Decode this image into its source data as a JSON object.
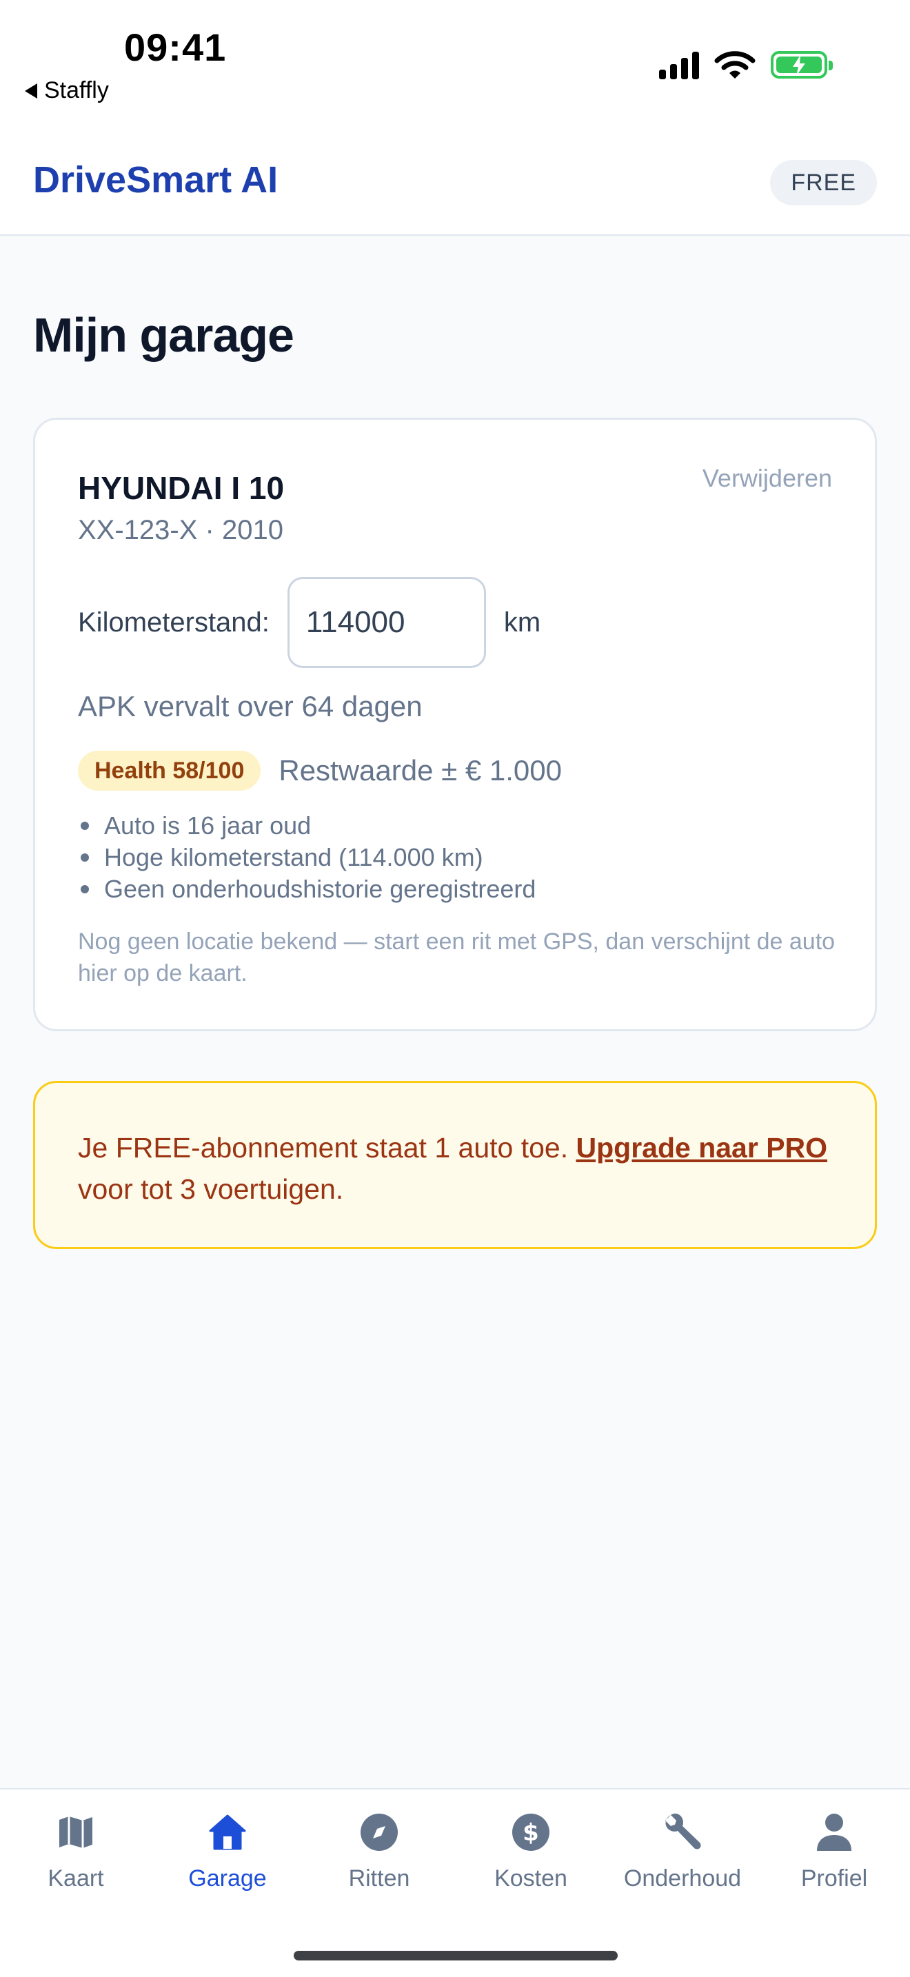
{
  "status_bar": {
    "time": "09:41",
    "back_app": "Staffly"
  },
  "header": {
    "brand": "DriveSmart AI",
    "plan": "FREE"
  },
  "page": {
    "title": "Mijn garage"
  },
  "vehicle_card": {
    "name": "HYUNDAI I 10",
    "remove_label": "Verwijderen",
    "plate": "XX-123-X",
    "meta_separator": " · ",
    "year": "2010",
    "odometer_label": "Kilometerstand:",
    "odometer_value": "114000",
    "odometer_unit": "km",
    "apk_text": "APK vervalt over 64 dagen",
    "health_badge": "Health 58/100",
    "health_score": 58,
    "residual_value": "Restwaarde ± € 1.000",
    "reasons": [
      "Auto is 16 jaar oud",
      "Hoge kilometerstand (114.000 km)",
      "Geen onderhoudshistorie geregistreerd"
    ],
    "location_note": "Nog geen locatie bekend — start een rit met GPS, dan verschijnt de auto hier op de kaart."
  },
  "upgrade_notice": {
    "text_before": "Je FREE-abonnement staat 1 auto toe. ",
    "link_text": "Upgrade naar PRO",
    "text_after": " voor tot 3 voertuigen."
  },
  "tabs": [
    {
      "label": "Kaart",
      "icon": "map-icon",
      "active": false
    },
    {
      "label": "Garage",
      "icon": "home-icon",
      "active": true
    },
    {
      "label": "Ritten",
      "icon": "compass-icon",
      "active": false
    },
    {
      "label": "Kosten",
      "icon": "dollar-icon",
      "active": false
    },
    {
      "label": "Onderhoud",
      "icon": "wrench-icon",
      "active": false
    },
    {
      "label": "Profiel",
      "icon": "user-icon",
      "active": false
    }
  ],
  "colors": {
    "brand": "#1e40af",
    "active_tab": "#1d4ed8",
    "inactive_tab": "#64748b",
    "health_bg": "#fef3c7",
    "health_text": "#92400e",
    "notice_bg": "#fffbeb",
    "notice_border": "#facc15",
    "notice_text": "#9a3412",
    "battery": "#34c759"
  }
}
